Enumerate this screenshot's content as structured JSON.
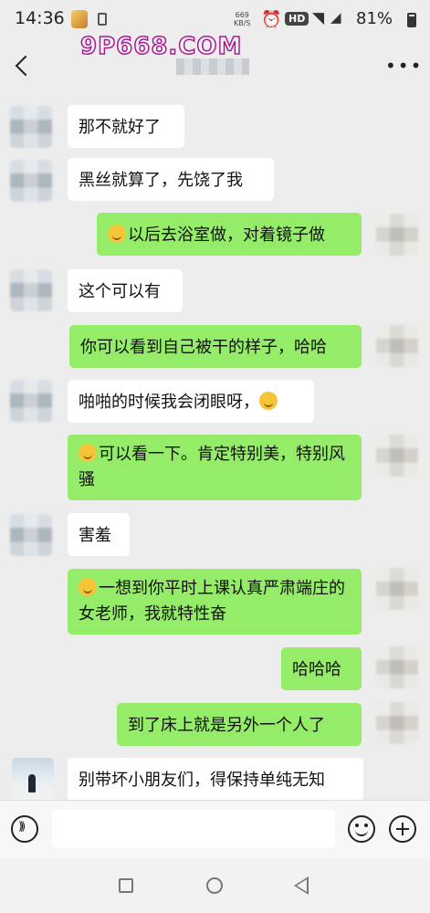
{
  "status_bar": {
    "time": "14:36",
    "net_speed_value": "669",
    "net_speed_unit": "KB/S",
    "hd_badge": "HD",
    "signal_label": "4G",
    "battery": "81%"
  },
  "header": {
    "watermark_logo": "9P668.COM"
  },
  "chat": {
    "messages": [
      {
        "side": "in",
        "text": "那不就好了"
      },
      {
        "side": "in",
        "text": "黑丝就算了，先饶了我"
      },
      {
        "side": "out",
        "emoji": "hot-face-emoji",
        "text": "以后去浴室做，对着镜子做"
      },
      {
        "side": "in",
        "text": "这个可以有"
      },
      {
        "side": "out",
        "text": "你可以看到自己被干的样子，哈哈"
      },
      {
        "side": "in",
        "text": "啪啪的时候我会闭眼呀，",
        "emoji": "laughing-emoji"
      },
      {
        "side": "out",
        "emoji": "hot-face-emoji",
        "text": "可以看一下。肯定特别美，特别风骚"
      },
      {
        "side": "in",
        "text": "害羞"
      },
      {
        "side": "out",
        "emoji": "thinking-emoji",
        "text": "一想到你平时上课认真严肃端庄的女老师，我就特性奋"
      },
      {
        "side": "out",
        "text": "哈哈哈"
      },
      {
        "side": "out",
        "text": "到了床上就是另外一个人了"
      },
      {
        "side": "in",
        "text": "别带坏小朋友们，得保持单纯无知"
      }
    ]
  },
  "colors": {
    "background": "#ededed",
    "incoming_bubble": "#ffffff",
    "outgoing_bubble": "#95ec69"
  },
  "icons": {
    "back": "chevron-left-icon",
    "more": "more-horizontal-icon",
    "voice": "voice-icon",
    "emoji": "emoji-icon",
    "plus": "plus-icon"
  }
}
